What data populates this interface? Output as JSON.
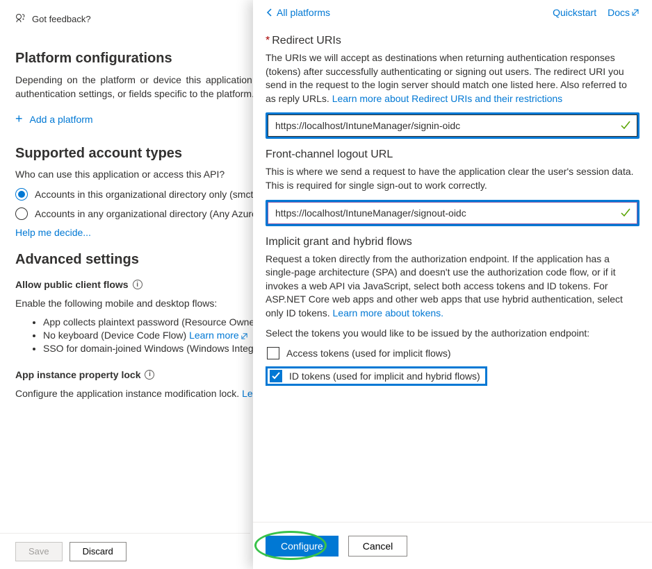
{
  "left": {
    "feedback": "Got feedback?",
    "h_platform": "Platform configurations",
    "platform_para": "Depending on the platform or device this application is targeting, additional configuration may be required such as redirect URIs, specific authentication settings, or fields specific to the platform.",
    "add_platform": "Add a platform",
    "h_accounts": "Supported account types",
    "accounts_q": "Who can use this application or access this API?",
    "radio1": "Accounts in this organizational directory only (smctest only - Single tenant)",
    "radio2": "Accounts in any organizational directory (Any Azure AD directory - Multitenant)",
    "help": "Help me decide...",
    "h_adv": "Advanced settings",
    "allow_public": "Allow public client flows",
    "enable_following": "Enable the following mobile and desktop flows:",
    "flow1": "App collects plaintext password (Resource Owner Password Credential Flow) ",
    "flow2_a": "No keyboard (Device Code Flow) ",
    "flow2_link": "Learn more",
    "flow3": "SSO for domain-joined Windows (Windows Integrated Auth Flow) ",
    "app_lock": "App instance property lock",
    "configure_lock_a": "Configure the application instance modification lock. ",
    "configure_lock_link": "Learn more",
    "save": "Save",
    "discard": "Discard"
  },
  "blade": {
    "all_platforms": "All platforms",
    "quickstart": "Quickstart",
    "docs": "Docs",
    "h_redirect": "Redirect URIs",
    "redirect_desc_a": "The URIs we will accept as destinations when returning authentication responses (tokens) after successfully authenticating or signing out users. The redirect URI you send in the request to the login server should match one listed here. Also referred to as reply URLs. ",
    "redirect_link": "Learn more about Redirect URIs and their restrictions",
    "redirect_val": "https://localhost/IntuneManager/signin-oidc",
    "h_front": "Front-channel logout URL",
    "front_desc": "This is where we send a request to have the application clear the user's session data. This is required for single sign-out to work correctly.",
    "front_val": "https://localhost/IntuneManager/signout-oidc",
    "h_implicit": "Implicit grant and hybrid flows",
    "implicit_desc_a": "Request a token directly from the authorization endpoint. If the application has a single-page architecture (SPA) and doesn't use the authorization code flow, or if it invokes a web API via JavaScript, select both access tokens and ID tokens. For ASP.NET Core web apps and other web apps that use hybrid authentication, select only ID tokens. ",
    "implicit_link": "Learn more about tokens.",
    "select_tokens": "Select the tokens you would like to be issued by the authorization endpoint:",
    "cb_access": "Access tokens (used for implicit flows)",
    "cb_id": "ID tokens (used for implicit and hybrid flows)",
    "configure": "Configure",
    "cancel": "Cancel"
  }
}
